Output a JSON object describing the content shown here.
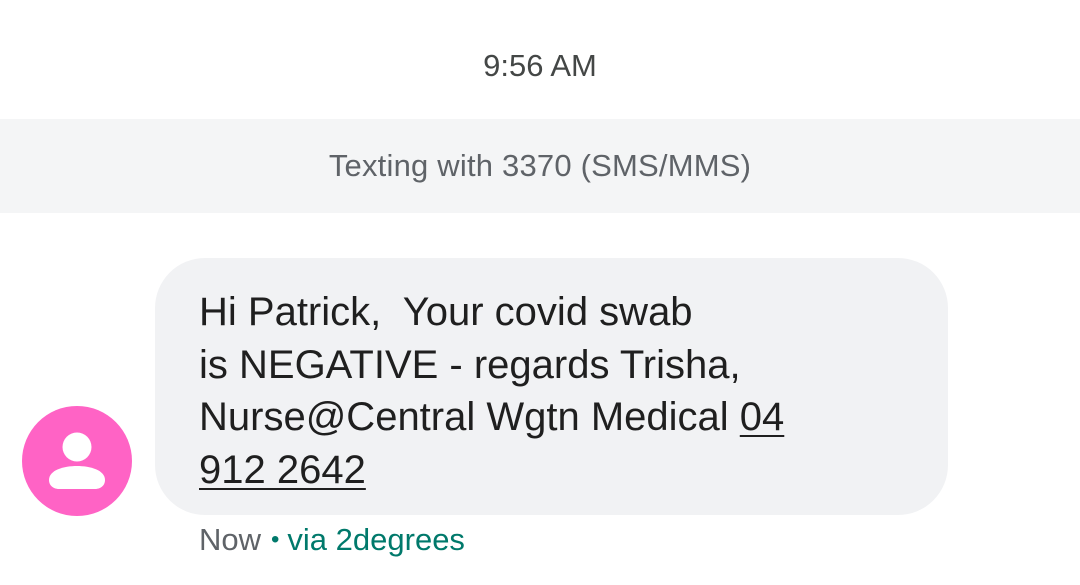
{
  "conversation": {
    "timestamp": "9:56 AM",
    "banner": "Texting with 3370 (SMS/MMS)"
  },
  "message": {
    "line1": "Hi Patrick,  Your covid swab",
    "line2": "is NEGATIVE - regards Trisha,",
    "line3_text": "Nurse@Central Wgtn Medical ",
    "phone_part1": "04",
    "phone_part2": "912 2642",
    "sent_time": "Now",
    "separator": "•",
    "carrier": "via 2degrees"
  },
  "avatar": {
    "icon": "person-icon",
    "color": "#ff63c5"
  },
  "colors": {
    "bubble": "#f1f2f4",
    "banner": "#f4f5f6",
    "carrier_accent": "#00796b"
  }
}
